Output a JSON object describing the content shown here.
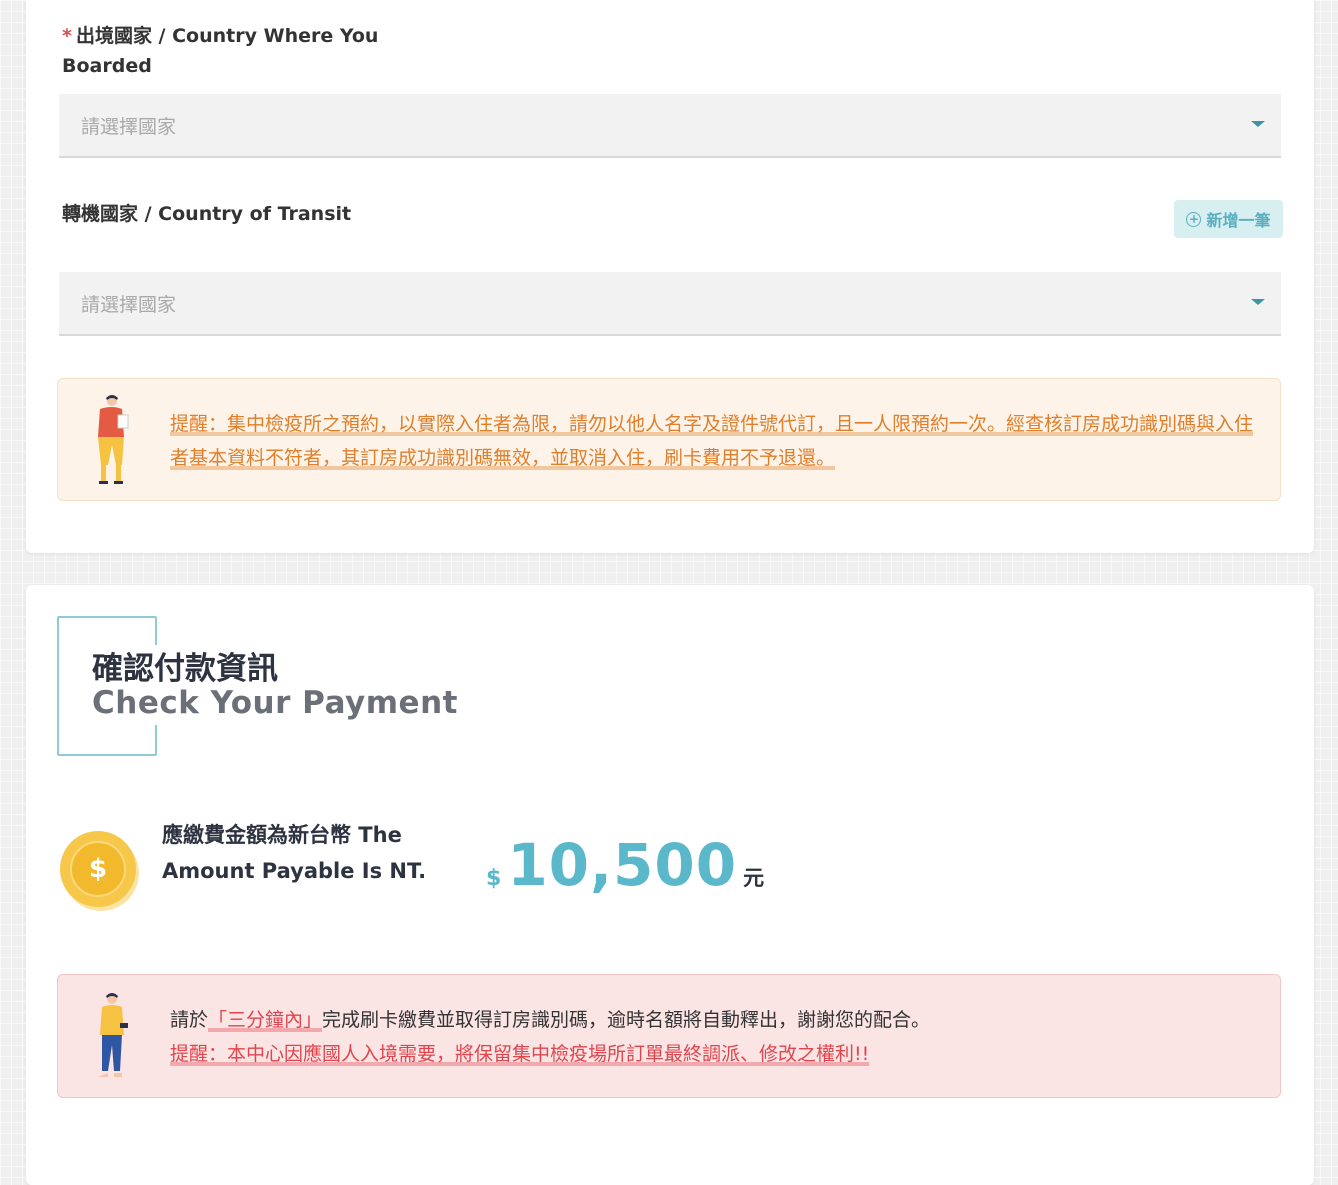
{
  "section_trip": {
    "boarded": {
      "required_mark": "*",
      "label": "出境國家 / Country Where You Boarded",
      "placeholder": "請選擇國家"
    },
    "transit": {
      "label": "轉機國家 / Country of Transit",
      "placeholder": "請選擇國家",
      "add_button": "新增一筆"
    },
    "notice": {
      "text": "提醒：集中檢疫所之預約，以實際入住者為限，請勿以他人名字及證件號代訂，且一人限預約一次。經查核訂房成功識別碼與入住者基本資料不符者，其訂房成功識別碼無效，並取消入住，刷卡費用不予退還。"
    }
  },
  "section_payment": {
    "title_zh": "確認付款資訊",
    "title_en": "Check Your Payment",
    "amount_label": "應繳費金額為新台幣 The Amount Payable Is NT.",
    "currency_symbol": "$",
    "amount": "10,500",
    "unit": "元",
    "notice": {
      "line1_pre": "請於",
      "line1_highlight": "「三分鐘內」",
      "line1_post": "完成刷卡繳費並取得訂房識別碼，逾時名額將自動釋出，謝謝您的配合。",
      "line2": "提醒：本中心因應國人入境需要，將保留集中檢疫場所訂單最終調派、修改之權利!!"
    }
  },
  "colors": {
    "accent": "#5bb8cb",
    "notice_orange": "#e07f2b",
    "notice_red": "#e0454d",
    "coin": "#f7c74a"
  },
  "icons": [
    "chevron-down-icon",
    "plus-circle-icon",
    "dollar-coin-icon",
    "person-illustration"
  ]
}
